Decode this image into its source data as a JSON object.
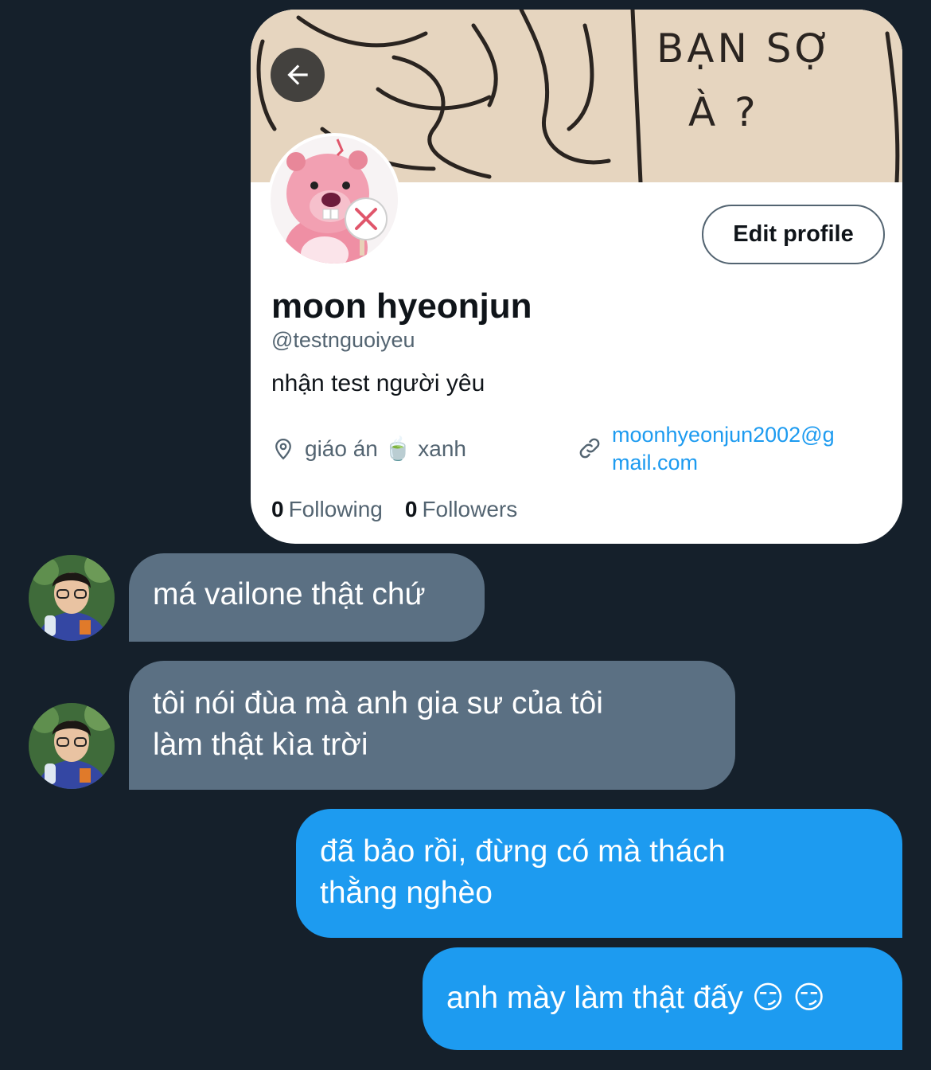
{
  "profile": {
    "banner_text_line1": "BẠN SỢ",
    "banner_text_line2": "À ?",
    "edit_label": "Edit profile",
    "display_name": "moon hyeonjun",
    "handle": "@testnguoiyeu",
    "bio": "nhận test người yêu",
    "location": "giáo án 🍵 xanh",
    "link_line1": "moonhyeonjun2002@g",
    "link_line2": "mail.com",
    "following_count": "0",
    "following_label": "Following",
    "followers_count": "0",
    "followers_label": "Followers"
  },
  "messages": [
    {
      "direction": "in",
      "lines": [
        "má vailone thật chứ"
      ]
    },
    {
      "direction": "in",
      "lines": [
        "tôi nói đùa mà anh gia sư của tôi",
        "làm thật kìa trời"
      ]
    },
    {
      "direction": "out",
      "lines": [
        "đã bảo rồi, đừng có mà thách",
        "thằng nghèo"
      ]
    },
    {
      "direction": "out",
      "lines": [
        "anh mày làm thật đấy 😏 😏"
      ]
    }
  ],
  "colors": {
    "background": "#15202b",
    "incoming_bubble": "#5b7083",
    "outgoing_bubble": "#1d9bf0",
    "link": "#1d9bf0"
  }
}
